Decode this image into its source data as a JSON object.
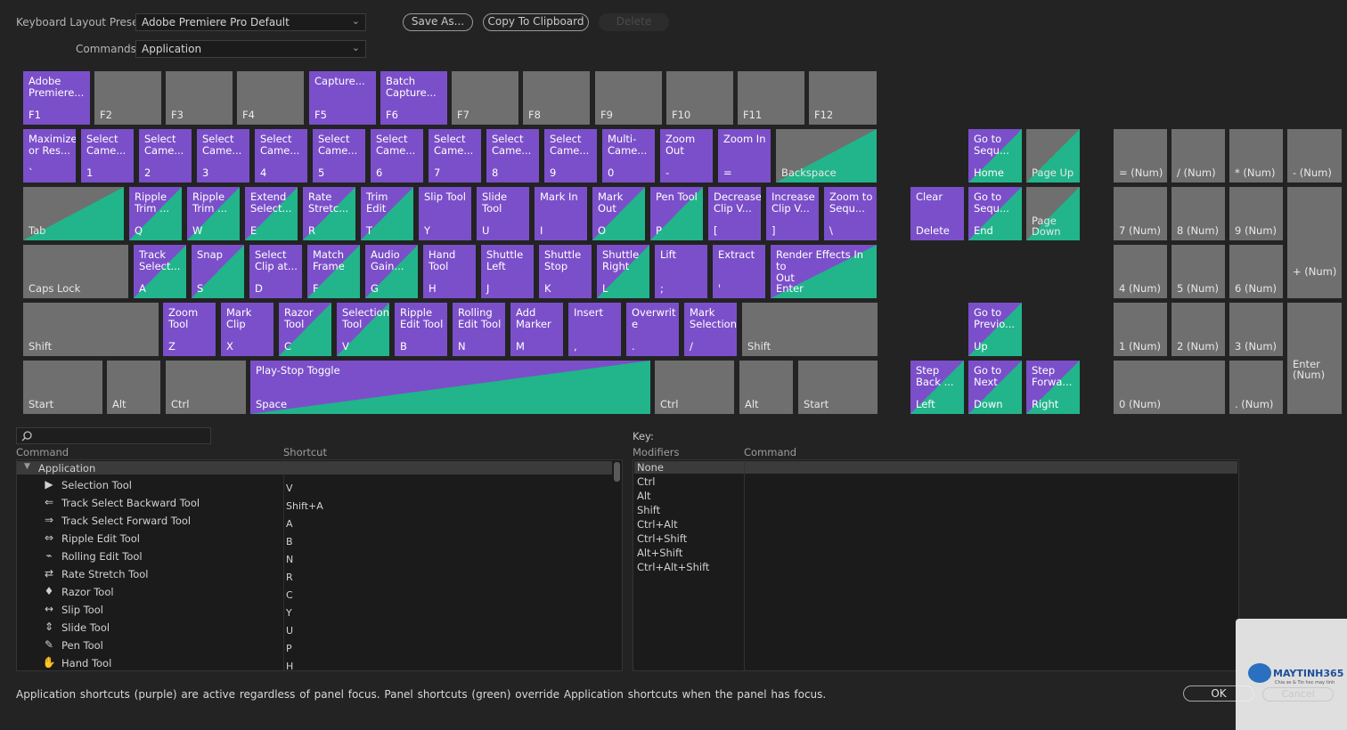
{
  "top": {
    "preset_label": "Keyboard Layout Preset:",
    "preset_value": "Adobe Premiere Pro Default",
    "commands_label": "Commands:",
    "commands_value": "Application",
    "save_as": "Save As...",
    "copy_clipboard": "Copy To Clipboard",
    "delete": "Delete"
  },
  "colors": {
    "application": "#7b4fc9",
    "panel": "#1fae84",
    "unassigned": "#6f6f6f"
  },
  "keys": {
    "f1": {
      "cmd": "Adobe\nPremiere...",
      "key": "F1"
    },
    "f2": {
      "cmd": "",
      "key": "F2"
    },
    "f3": {
      "cmd": "",
      "key": "F3"
    },
    "f4": {
      "cmd": "",
      "key": "F4"
    },
    "f5": {
      "cmd": "Capture...",
      "key": "F5"
    },
    "f6": {
      "cmd": "Batch\nCapture...",
      "key": "F6"
    },
    "f7": {
      "cmd": "",
      "key": "F7"
    },
    "f8": {
      "cmd": "",
      "key": "F8"
    },
    "f9": {
      "cmd": "",
      "key": "F9"
    },
    "f10": {
      "cmd": "",
      "key": "F10"
    },
    "f11": {
      "cmd": "",
      "key": "F11"
    },
    "f12": {
      "cmd": "",
      "key": "F12"
    },
    "grave": {
      "cmd": "Maximize\nor Res...",
      "key": "`"
    },
    "n1": {
      "cmd": "Select\nCame...",
      "key": "1"
    },
    "n2": {
      "cmd": "Select\nCame...",
      "key": "2"
    },
    "n3": {
      "cmd": "Select\nCame...",
      "key": "3"
    },
    "n4": {
      "cmd": "Select\nCame...",
      "key": "4"
    },
    "n5": {
      "cmd": "Select\nCame...",
      "key": "5"
    },
    "n6": {
      "cmd": "Select\nCame...",
      "key": "6"
    },
    "n7": {
      "cmd": "Select\nCame...",
      "key": "7"
    },
    "n8": {
      "cmd": "Select\nCame...",
      "key": "8"
    },
    "n9": {
      "cmd": "Select\nCame...",
      "key": "9"
    },
    "n0": {
      "cmd": "Multi-\nCame...",
      "key": "0"
    },
    "minus": {
      "cmd": "Zoom\nOut",
      "key": "-"
    },
    "equal": {
      "cmd": "Zoom In",
      "key": "="
    },
    "backspace": {
      "cmd": "",
      "key": "Backspace"
    },
    "tab": {
      "cmd": "",
      "key": "Tab"
    },
    "q": {
      "cmd": "Ripple\nTrim ...",
      "key": "Q"
    },
    "w": {
      "cmd": "Ripple\nTrim ...",
      "key": "W"
    },
    "e": {
      "cmd": "Extend\nSelect...",
      "key": "E"
    },
    "r": {
      "cmd": "Rate\nStretc...",
      "key": "R"
    },
    "t": {
      "cmd": "Trim Edit",
      "key": "T"
    },
    "y": {
      "cmd": "Slip Tool",
      "key": "Y"
    },
    "u": {
      "cmd": "Slide\nTool",
      "key": "U"
    },
    "i": {
      "cmd": "Mark In",
      "key": "I"
    },
    "o": {
      "cmd": "Mark Out",
      "key": "O"
    },
    "p": {
      "cmd": "Pen Tool",
      "key": "P"
    },
    "lbracket": {
      "cmd": "Decrease\nClip V...",
      "key": "["
    },
    "rbracket": {
      "cmd": "Increase\nClip V...",
      "key": "]"
    },
    "backslash": {
      "cmd": "Zoom to\nSequ...",
      "key": "\\"
    },
    "caps": {
      "cmd": "",
      "key": "Caps Lock"
    },
    "a": {
      "cmd": "Track\nSelect...",
      "key": "A"
    },
    "s": {
      "cmd": "Snap",
      "key": "S"
    },
    "d": {
      "cmd": "Select\nClip at...",
      "key": "D"
    },
    "f": {
      "cmd": "Match\nFrame",
      "key": "F"
    },
    "g": {
      "cmd": "Audio\nGain...",
      "key": "G"
    },
    "h": {
      "cmd": "Hand\nTool",
      "key": "H"
    },
    "j": {
      "cmd": "Shuttle\nLeft",
      "key": "J"
    },
    "k": {
      "cmd": "Shuttle\nStop",
      "key": "K"
    },
    "l": {
      "cmd": "Shuttle\nRight",
      "key": "L"
    },
    "semicolon": {
      "cmd": "Lift",
      "key": ";"
    },
    "quote": {
      "cmd": "Extract",
      "key": "'"
    },
    "enter": {
      "cmd": "Render Effects In to\nOut",
      "key": "Enter"
    },
    "lshift": {
      "cmd": "",
      "key": "Shift"
    },
    "z": {
      "cmd": "Zoom\nTool",
      "key": "Z"
    },
    "x": {
      "cmd": "Mark Clip",
      "key": "X"
    },
    "c": {
      "cmd": "Razor\nTool",
      "key": "C"
    },
    "v": {
      "cmd": "Selection\nTool",
      "key": "V"
    },
    "b": {
      "cmd": "Ripple\nEdit Tool",
      "key": "B"
    },
    "n": {
      "cmd": "Rolling\nEdit Tool",
      "key": "N"
    },
    "m": {
      "cmd": "Add\nMarker",
      "key": "M"
    },
    "comma": {
      "cmd": "Insert",
      "key": ","
    },
    "period": {
      "cmd": "Overwrit\ne",
      "key": "."
    },
    "slash": {
      "cmd": "Mark\nSelection",
      "key": "/"
    },
    "rshift": {
      "cmd": "",
      "key": "Shift"
    },
    "lstart": {
      "cmd": "",
      "key": "Start"
    },
    "lalt": {
      "cmd": "",
      "key": "Alt"
    },
    "lctrl": {
      "cmd": "",
      "key": "Ctrl"
    },
    "space": {
      "cmd": "Play-Stop Toggle",
      "key": "Space"
    },
    "rctrl": {
      "cmd": "",
      "key": "Ctrl"
    },
    "ralt": {
      "cmd": "",
      "key": "Alt"
    },
    "rstart": {
      "cmd": "",
      "key": "Start"
    },
    "home": {
      "cmd": "Go to\nSequ...",
      "key": "Home"
    },
    "pageup": {
      "cmd": "",
      "key": "Page Up"
    },
    "delete": {
      "cmd": "Clear",
      "key": "Delete"
    },
    "end": {
      "cmd": "Go to\nSequ...",
      "key": "End"
    },
    "pagedown": {
      "cmd": "",
      "key": "Page\nDown"
    },
    "up": {
      "cmd": "Go to\nPrevio...",
      "key": "Up"
    },
    "left": {
      "cmd": "Step\nBack ...",
      "key": "Left"
    },
    "down": {
      "cmd": "Go to\nNext",
      "key": "Down"
    },
    "right": {
      "cmd": "Step\nForwa...",
      "key": "Right"
    },
    "num_eq": {
      "cmd": "",
      "key": "= (Num)"
    },
    "num_div": {
      "cmd": "",
      "key": "/ (Num)"
    },
    "num_mul": {
      "cmd": "",
      "key": "* (Num)"
    },
    "num_sub": {
      "cmd": "",
      "key": "- (Num)"
    },
    "num7": {
      "cmd": "",
      "key": "7 (Num)"
    },
    "num8": {
      "cmd": "",
      "key": "8 (Num)"
    },
    "num9": {
      "cmd": "",
      "key": "9 (Num)"
    },
    "num_add": {
      "cmd": "",
      "key": "+ (Num)"
    },
    "num4": {
      "cmd": "",
      "key": "4 (Num)"
    },
    "num5": {
      "cmd": "",
      "key": "5 (Num)"
    },
    "num6": {
      "cmd": "",
      "key": "6 (Num)"
    },
    "num1": {
      "cmd": "",
      "key": "1 (Num)"
    },
    "num2": {
      "cmd": "",
      "key": "2 (Num)"
    },
    "num3": {
      "cmd": "",
      "key": "3 (Num)"
    },
    "num_enter": {
      "cmd": "",
      "key": "Enter\n(Num)"
    },
    "num0": {
      "cmd": "",
      "key": "0 (Num)"
    },
    "num_dot": {
      "cmd": "",
      "key": ". (Num)"
    }
  },
  "list": {
    "col_command": "Command",
    "col_shortcut": "Shortcut",
    "group": "Application",
    "rows": [
      {
        "name": "Selection Tool",
        "shortcut": "V",
        "icon": "selection-arrow-icon"
      },
      {
        "name": "Track Select Backward Tool",
        "shortcut": "Shift+A",
        "icon": "track-select-backward-icon"
      },
      {
        "name": "Track Select Forward Tool",
        "shortcut": "A",
        "icon": "track-select-forward-icon"
      },
      {
        "name": "Ripple Edit Tool",
        "shortcut": "B",
        "icon": "ripple-edit-icon"
      },
      {
        "name": "Rolling Edit Tool",
        "shortcut": "N",
        "icon": "rolling-edit-icon"
      },
      {
        "name": "Rate Stretch Tool",
        "shortcut": "R",
        "icon": "rate-stretch-icon"
      },
      {
        "name": "Razor Tool",
        "shortcut": "C",
        "icon": "razor-icon"
      },
      {
        "name": "Slip Tool",
        "shortcut": "Y",
        "icon": "slip-icon"
      },
      {
        "name": "Slide Tool",
        "shortcut": "U",
        "icon": "slide-icon"
      },
      {
        "name": "Pen Tool",
        "shortcut": "P",
        "icon": "pen-icon"
      },
      {
        "name": "Hand Tool",
        "shortcut": "H",
        "icon": "hand-icon"
      }
    ]
  },
  "legend": {
    "key_label": "Key:",
    "col_modifiers": "Modifiers",
    "col_command": "Command",
    "modifiers": [
      "None",
      "Ctrl",
      "Alt",
      "Shift",
      "Ctrl+Alt",
      "Ctrl+Shift",
      "Alt+Shift",
      "Ctrl+Alt+Shift"
    ]
  },
  "footer": {
    "note": "Application shortcuts (purple) are active regardless of panel focus. Panel shortcuts (green) override Application shortcuts when the panel has focus.",
    "ok": "OK",
    "cancel": "Cancel"
  },
  "watermark": {
    "brand": "MAYTINH365",
    "tagline": "Chia se & Tin hoc may tinh"
  }
}
